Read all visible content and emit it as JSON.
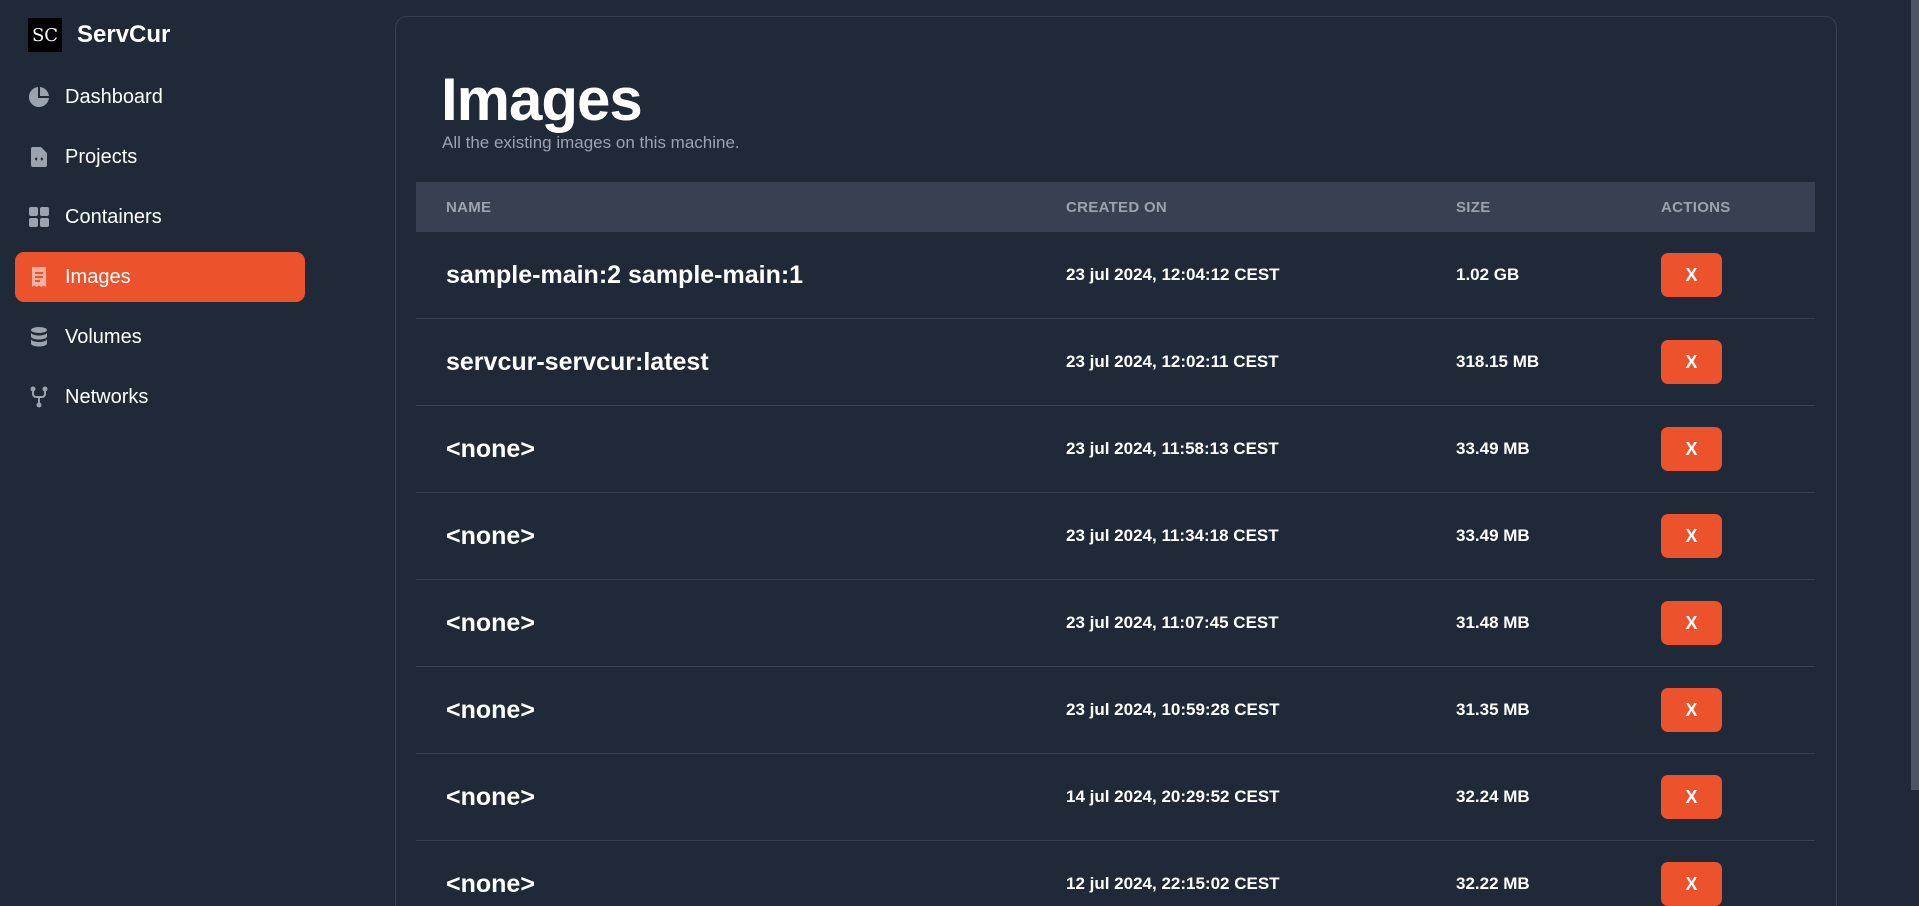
{
  "brand": {
    "logo_text": "SC",
    "name": "ServCur"
  },
  "sidebar": {
    "items": [
      {
        "label": "Dashboard",
        "icon": "pie-chart-icon",
        "active": false
      },
      {
        "label": "Projects",
        "icon": "code-file-icon",
        "active": false
      },
      {
        "label": "Containers",
        "icon": "grid-icon",
        "active": false
      },
      {
        "label": "Images",
        "icon": "receipt-icon",
        "active": true
      },
      {
        "label": "Volumes",
        "icon": "database-icon",
        "active": false
      },
      {
        "label": "Networks",
        "icon": "network-fork-icon",
        "active": false
      }
    ]
  },
  "main": {
    "title": "Images",
    "subtitle": "All the existing images on this machine.",
    "table": {
      "headers": {
        "name": "NAME",
        "created": "CREATED ON",
        "size": "SIZE",
        "actions": "ACTIONS"
      },
      "rows": [
        {
          "name": "sample-main:2 sample-main:1",
          "created": "23 jul 2024, 12:04:12 CEST",
          "size": "1.02 GB",
          "action": "X"
        },
        {
          "name": "servcur-servcur:latest",
          "created": "23 jul 2024, 12:02:11 CEST",
          "size": "318.15 MB",
          "action": "X"
        },
        {
          "name": "<none>",
          "created": "23 jul 2024, 11:58:13 CEST",
          "size": "33.49 MB",
          "action": "X"
        },
        {
          "name": "<none>",
          "created": "23 jul 2024, 11:34:18 CEST",
          "size": "33.49 MB",
          "action": "X"
        },
        {
          "name": "<none>",
          "created": "23 jul 2024, 11:07:45 CEST",
          "size": "31.48 MB",
          "action": "X"
        },
        {
          "name": "<none>",
          "created": "23 jul 2024, 10:59:28 CEST",
          "size": "31.35 MB",
          "action": "X"
        },
        {
          "name": "<none>",
          "created": "14 jul 2024, 20:29:52 CEST",
          "size": "32.24 MB",
          "action": "X"
        },
        {
          "name": "<none>",
          "created": "12 jul 2024, 22:15:02 CEST",
          "size": "32.22 MB",
          "action": "X"
        }
      ]
    }
  },
  "colors": {
    "accent": "#ec522c",
    "background": "#1f2937",
    "table_header": "#374151"
  }
}
